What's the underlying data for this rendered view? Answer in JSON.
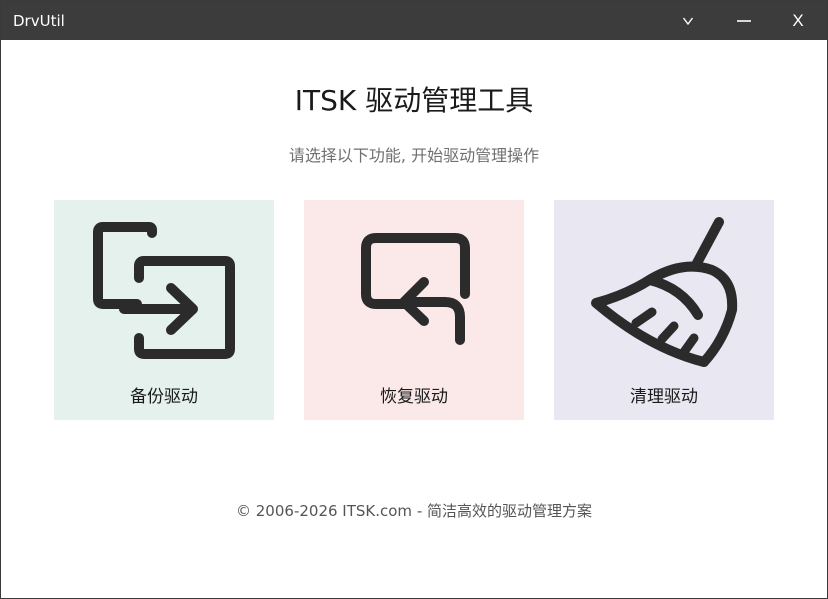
{
  "window": {
    "title": "DrvUtil",
    "buttons": {
      "menu_icon": "chevron-down-icon",
      "minimize_icon": "minimize-icon",
      "close_label": "X"
    },
    "titlebar_color": "#3c3c3c"
  },
  "header": {
    "title": "ITSK 驱动管理工具",
    "subtitle": "请选择以下功能, 开始驱动管理操作"
  },
  "cards": [
    {
      "label": "备份驱动",
      "icon": "backup-export-icon",
      "background": "#e4f1ec"
    },
    {
      "label": "恢复驱动",
      "icon": "restore-return-icon",
      "background": "#fbe9e9"
    },
    {
      "label": "清理驱动",
      "icon": "broom-icon",
      "background": "#e8e7f2"
    }
  ],
  "footer": {
    "text": "© 2006-2026 ITSK.com - 简洁高效的驱动管理方案"
  }
}
